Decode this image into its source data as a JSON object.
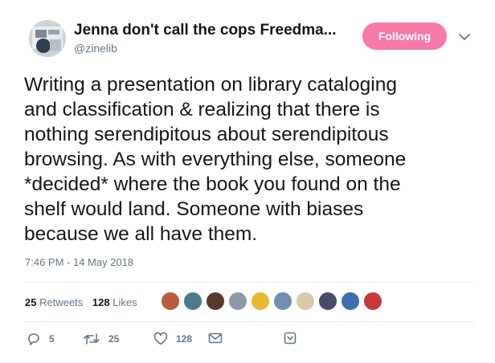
{
  "author": {
    "name": "Jenna don't call the cops Freedma...",
    "handle": "@zinelib"
  },
  "follow_button": {
    "label": "Following"
  },
  "tweet": {
    "text": "Writing a presentation on library cataloging\nand classification & realizing that there is\nnothing serendipitous about serendipitous\nbrowsing. As with everything else, someone\n*decided* where the book you found on the\nshelf would land. Someone with biases\nbecause we all have them.",
    "timestamp": "7:46 PM - 14 May 2018"
  },
  "stats": {
    "retweets_count": "25",
    "retweets_label": "Retweets",
    "likes_count": "128",
    "likes_label": "Likes"
  },
  "liker_avatars": [
    {
      "color": "#b85c3c"
    },
    {
      "color": "#4f7a8c"
    },
    {
      "color": "#5a3a2e"
    },
    {
      "color": "#8d9aa6"
    },
    {
      "color": "#e8b832"
    },
    {
      "color": "#6f8fb0"
    },
    {
      "color": "#d9c9a8"
    },
    {
      "color": "#4a4a6a"
    },
    {
      "color": "#3f6cae"
    },
    {
      "color": "#c83a3a"
    }
  ],
  "actions": {
    "reply_count": "5",
    "retweet_count": "25",
    "like_count": "128"
  },
  "icons": {
    "reply": "reply-icon",
    "retweet": "retweet-icon",
    "like": "heart-icon",
    "dm": "envelope-icon",
    "bookmark": "caret-icon"
  },
  "colors": {
    "follow_button": "#f779a7",
    "muted_text": "#657786"
  }
}
